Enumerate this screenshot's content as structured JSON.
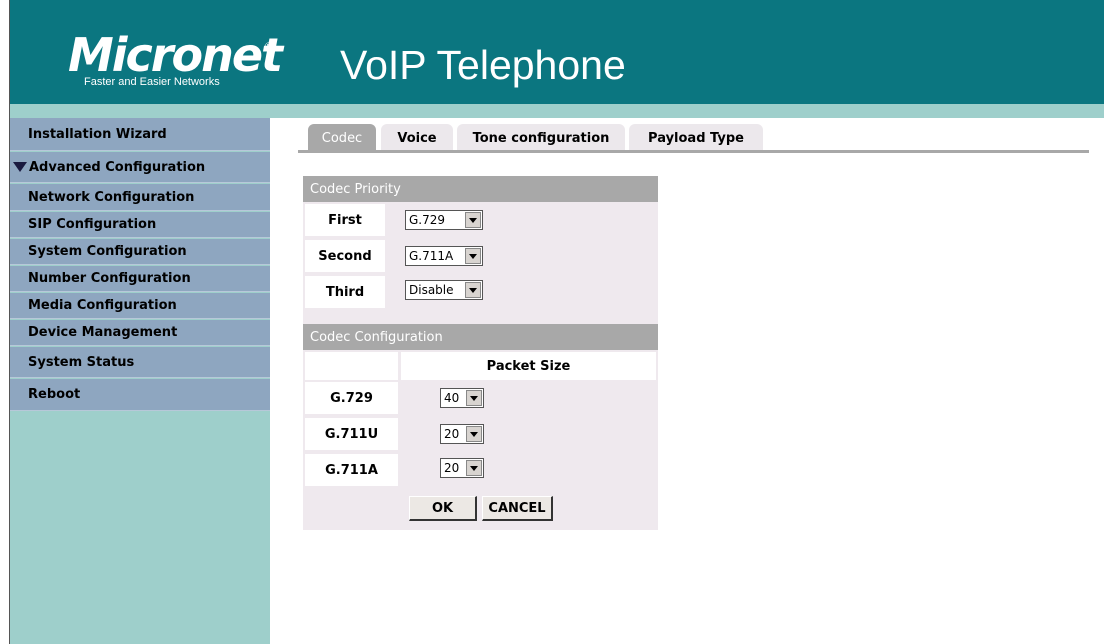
{
  "header": {
    "logo_text": "Micronet",
    "logo_reg": "®",
    "logo_tagline": "Faster and Easier Networks",
    "title": "VoIP Telephone"
  },
  "sidebar": {
    "items": [
      {
        "label": "Installation Wizard"
      },
      {
        "label": "Advanced Configuration"
      },
      {
        "label": "Network Configuration"
      },
      {
        "label": "SIP Configuration"
      },
      {
        "label": "System Configuration"
      },
      {
        "label": "Number Configuration"
      },
      {
        "label": "Media Configuration"
      },
      {
        "label": "Device Management"
      },
      {
        "label": "System Status"
      },
      {
        "label": "Reboot"
      }
    ]
  },
  "tabs": [
    {
      "label": "Codec",
      "active": true
    },
    {
      "label": "Voice",
      "active": false
    },
    {
      "label": "Tone configuration",
      "active": false
    },
    {
      "label": "Payload Type",
      "active": false
    }
  ],
  "codec_priority": {
    "heading": "Codec Priority",
    "rows": [
      {
        "label": "First",
        "value": "G.729"
      },
      {
        "label": "Second",
        "value": "G.711A"
      },
      {
        "label": "Third",
        "value": "Disable"
      }
    ]
  },
  "codec_configuration": {
    "heading": "Codec Configuration",
    "column_header": "Packet Size",
    "rows": [
      {
        "codec": "G.729",
        "packet_size": "40"
      },
      {
        "codec": "G.711U",
        "packet_size": "20"
      },
      {
        "codec": "G.711A",
        "packet_size": "20"
      }
    ]
  },
  "buttons": {
    "ok": "OK",
    "cancel": "CANCEL"
  },
  "colors": {
    "header_bg": "#0b7680",
    "sidebar_bg": "#9ecfcb",
    "sidebar_item_bg": "#8ea6c0",
    "tab_active_bg": "#a8a8a8",
    "panel_bg": "#efe9ee"
  }
}
